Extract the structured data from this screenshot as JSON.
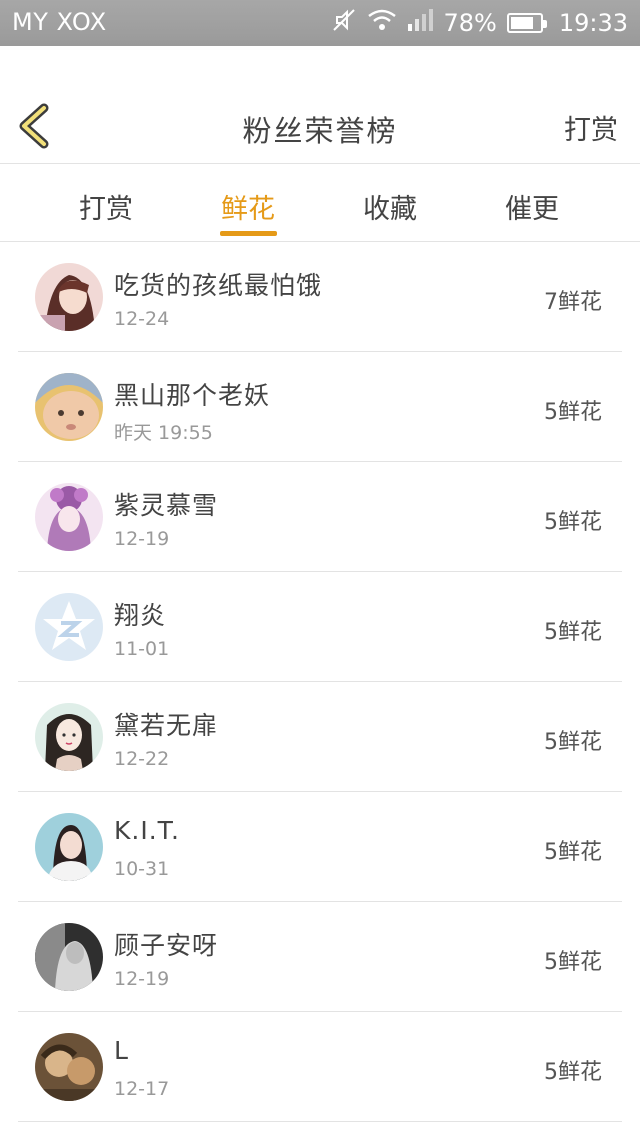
{
  "status": {
    "carrier": "MY XOX",
    "battery_text": "78%",
    "battery_level": 0.78,
    "time": "19:33",
    "icons": [
      "mute-icon",
      "wifi-icon",
      "signal-icon",
      "battery-icon"
    ]
  },
  "header": {
    "back_icon": "chevron-left-icon",
    "title": "粉丝荣誉榜",
    "action_label": "打赏"
  },
  "tabs": [
    {
      "label": "打赏",
      "active": false
    },
    {
      "label": "鲜花",
      "active": true
    },
    {
      "label": "收藏",
      "active": false
    },
    {
      "label": "催更",
      "active": false
    }
  ],
  "accent_color": "#e59a18",
  "fans": [
    {
      "name": "吃货的孩纸最怕饿",
      "date": "12-24",
      "count": "7鲜花"
    },
    {
      "name": "黑山那个老妖",
      "date": "昨天 19:55",
      "count": "5鲜花"
    },
    {
      "name": "紫灵慕雪",
      "date": "12-19",
      "count": "5鲜花"
    },
    {
      "name": "翔炎",
      "date": "11-01",
      "count": "5鲜花"
    },
    {
      "name": "黛若无扉",
      "date": "12-22",
      "count": "5鲜花"
    },
    {
      "name": "K.I.T.",
      "date": "10-31",
      "count": "5鲜花"
    },
    {
      "name": "顾子安呀",
      "date": "12-19",
      "count": "5鲜花"
    },
    {
      "name": "L",
      "date": "12-17",
      "count": "5鲜花"
    }
  ]
}
